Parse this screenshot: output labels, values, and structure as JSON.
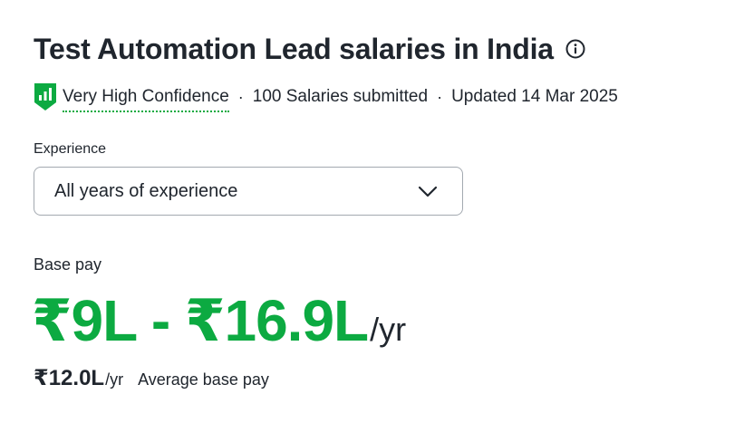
{
  "header": {
    "title": "Test Automation Lead salaries in India",
    "info_icon": "info-circle-icon"
  },
  "meta": {
    "confidence_icon": "bar-chart-shield-icon",
    "confidence_label": "Very High Confidence",
    "separator": "·",
    "salaries_submitted": "100 Salaries submitted",
    "updated": "Updated 14 Mar 2025"
  },
  "experience": {
    "label": "Experience",
    "selected": "All years of experience",
    "icon": "chevron-down-icon"
  },
  "base_pay": {
    "label": "Base pay",
    "range": "₹9L - ₹16.9L",
    "range_unit": "/yr",
    "average_value": "₹12.0L",
    "average_unit": "/yr",
    "average_label": "Average base pay"
  },
  "colors": {
    "accent_green": "#0caa41",
    "text": "#20262e",
    "border": "#a3a9b0"
  }
}
